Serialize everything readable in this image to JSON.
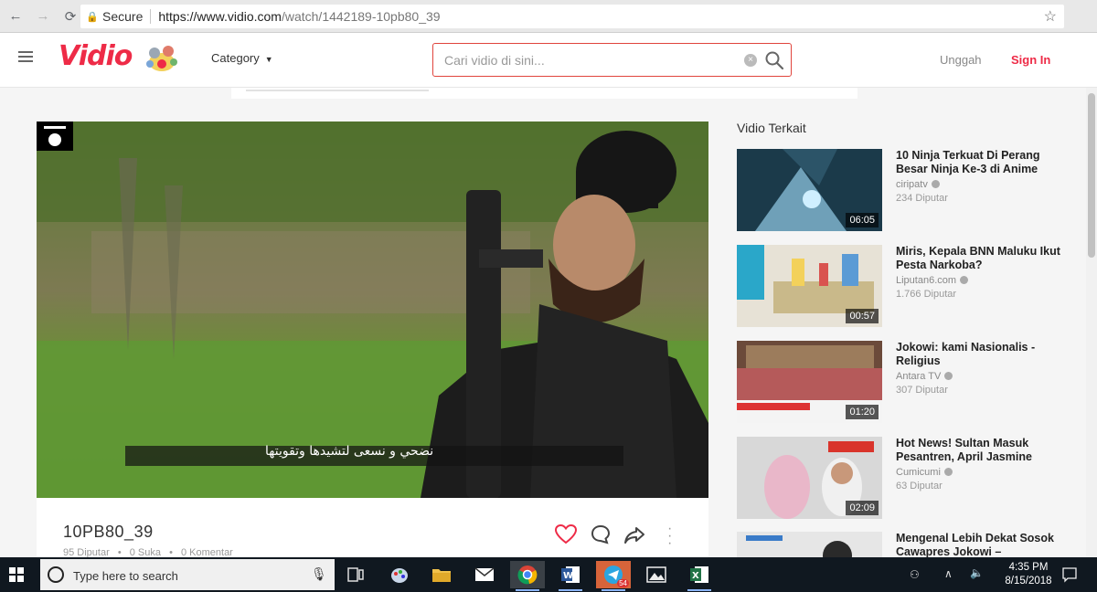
{
  "browser": {
    "secure_label": "Secure",
    "url_host": "https://www.vidio.com",
    "url_path": "/watch/1442189-10pb80_39"
  },
  "header": {
    "logo_text": "Vidio",
    "category_label": "Category",
    "search_placeholder": "Cari vidio di sini...",
    "upload_label": "Unggah",
    "signin_label": "Sign In",
    "brand_color": "#ee2b47"
  },
  "video": {
    "title": "10PB80_39",
    "subtitle": "نضحي و نسعى لتشيدها وتقويتها",
    "views": "95 Diputar",
    "likes": "0 Suka",
    "comments": "0 Komentar"
  },
  "related": {
    "heading": "Vidio Terkait",
    "items": [
      {
        "title": "10 Ninja Terkuat Di Perang Besar Ninja Ke-3 di Anime",
        "channel": "ciripatv",
        "views": "234 Diputar",
        "duration": "06:05"
      },
      {
        "title": "Miris, Kepala BNN Maluku Ikut Pesta Narkoba?",
        "channel": "Liputan6.com",
        "views": "1.766 Diputar",
        "duration": "00:57"
      },
      {
        "title": "Jokowi: kami Nasionalis - Religius",
        "channel": "Antara TV",
        "views": "307 Diputar",
        "duration": "01:20"
      },
      {
        "title": "Hot News! Sultan Masuk Pesantren, April Jasmine",
        "channel": "Cumicumi",
        "views": "63 Diputar",
        "duration": "02:09"
      },
      {
        "title": "Mengenal Lebih Dekat Sosok Cawapres Jokowi –",
        "channel": "",
        "views": "",
        "duration": ""
      }
    ]
  },
  "taskbar": {
    "search_text": "Type here to search",
    "time": "4:35 PM",
    "date": "8/15/2018",
    "telegram_badge": "54"
  }
}
